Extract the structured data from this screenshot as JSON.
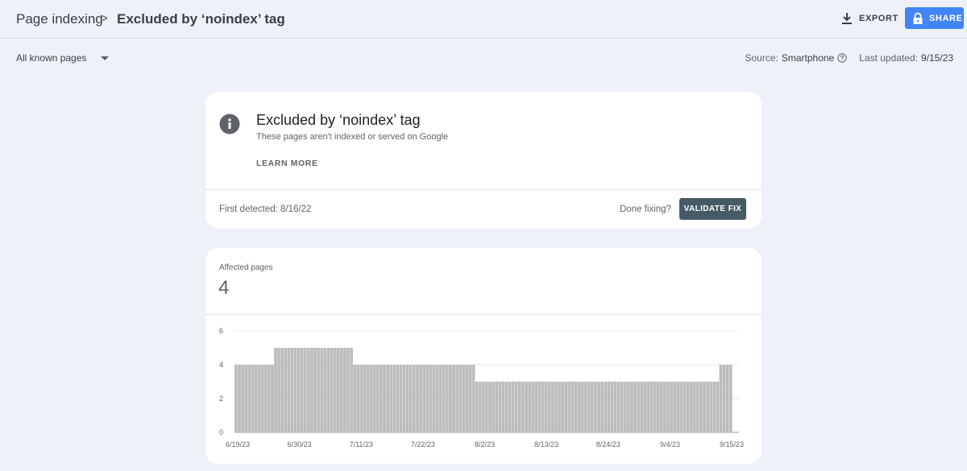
{
  "breadcrumb": {
    "root": "Page indexing",
    "separator": ">",
    "current": "Excluded by ‘noindex’ tag"
  },
  "header": {
    "export_label": "EXPORT",
    "share_label": "SHARE"
  },
  "filter": {
    "selected": "All known pages"
  },
  "meta": {
    "source_label": "Source:",
    "source_value": "Smartphone",
    "updated_label": "Last updated:",
    "updated_value": "9/15/23"
  },
  "issue": {
    "title": "Excluded by ‘noindex’ tag",
    "description": "These pages aren't indexed or served on Google",
    "learn_more": "LEARN MORE",
    "first_detected": "First detected: 8/16/22",
    "done_fixing": "Done fixing?",
    "validate_label": "VALIDATE FIX"
  },
  "affected": {
    "label": "Affected pages",
    "value": "4"
  },
  "colors": {
    "accent": "#4285f4",
    "validate": "#455a64",
    "bar": "#bdbdbd",
    "background": "#eef1f8"
  },
  "icons": {
    "export": "download-icon",
    "share": "lock-icon",
    "help": "help-circle-icon",
    "info": "info-icon",
    "dropdown": "caret-down-icon"
  },
  "chart_data": {
    "type": "bar",
    "y_ticks": [
      0,
      2,
      4,
      6
    ],
    "ylim": [
      0,
      6
    ],
    "x_tick_labels": [
      "6/19/23",
      "6/30/23",
      "7/11/23",
      "7/22/23",
      "8/2/23",
      "8/13/23",
      "8/24/23",
      "9/4/23",
      "9/15/23"
    ],
    "series": [
      {
        "values": [
          4,
          4,
          4,
          4,
          4,
          4,
          4,
          4,
          4,
          4,
          4,
          4,
          5,
          5,
          5,
          5,
          5,
          5,
          5,
          5,
          5,
          5,
          5,
          5,
          5,
          5,
          5,
          5,
          5,
          5,
          5,
          5,
          5,
          5,
          5,
          5,
          4,
          4,
          4,
          4,
          4,
          4,
          4,
          4,
          4,
          4,
          4,
          4,
          4,
          4,
          4,
          4,
          4,
          4,
          4,
          4,
          4,
          4,
          4,
          4,
          4,
          4,
          4,
          4,
          4,
          4,
          4,
          4,
          4,
          4,
          4,
          4,
          4,
          3,
          3,
          3,
          3,
          3,
          3,
          3,
          3,
          3,
          3,
          3,
          3,
          3,
          3,
          3,
          3,
          3,
          3,
          3,
          3,
          3,
          3,
          3,
          3,
          3,
          3,
          3,
          3,
          3,
          3,
          3,
          3,
          3,
          3,
          3,
          3,
          3,
          3,
          3,
          3,
          3,
          3,
          3,
          3,
          3,
          3,
          3,
          3,
          3,
          3,
          3,
          3,
          3,
          3,
          3,
          3,
          3,
          3,
          3,
          3,
          3,
          3,
          3,
          3,
          3,
          3,
          3,
          3,
          3,
          3,
          3,
          3,
          3,
          3,
          4,
          4,
          4,
          4
        ]
      }
    ]
  }
}
